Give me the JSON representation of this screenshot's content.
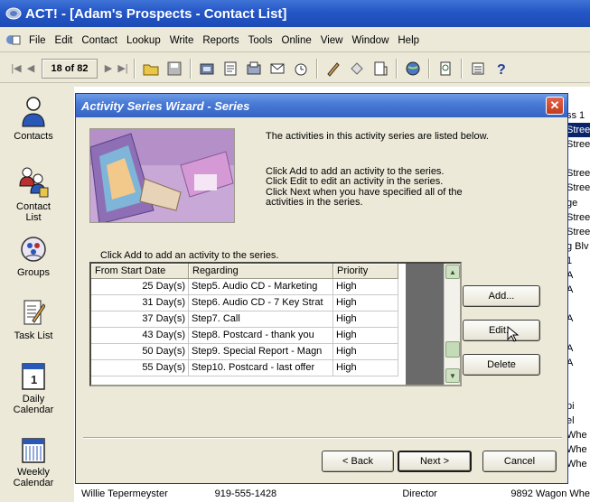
{
  "window": {
    "title": "ACT! - [Adam's Prospects - Contact List]"
  },
  "menubar": {
    "items": [
      "File",
      "Edit",
      "Contact",
      "Lookup",
      "Write",
      "Reports",
      "Tools",
      "Online",
      "View",
      "Window",
      "Help"
    ]
  },
  "toolbar": {
    "record_counter": "18 of 82"
  },
  "sidebar": {
    "items": [
      {
        "label": "Contacts",
        "icon": "person-icon"
      },
      {
        "label": "Contact List",
        "icon": "people-list-icon"
      },
      {
        "label": "Groups",
        "icon": "groups-icon"
      },
      {
        "label": "Task List",
        "icon": "task-list-icon"
      },
      {
        "label": "Daily Calendar",
        "icon": "daily-calendar-icon"
      },
      {
        "label": "Weekly Calendar",
        "icon": "weekly-calendar-icon"
      }
    ]
  },
  "background_list": {
    "column_fragments": [
      "ss 1",
      "Stree",
      "Stree",
      "",
      "Stree",
      "Stree",
      "ge",
      "Stree",
      "Stree",
      "g Blv",
      "1",
      "A",
      "A",
      "",
      "A",
      "",
      "A",
      "A",
      "",
      "",
      "pi",
      "el",
      "Whe",
      "Whe",
      "Whe"
    ],
    "bottom_row": {
      "name": "Willie Tepermeyster",
      "phone": "919-555-1428",
      "title": "Director",
      "address": "9892 Wagon Whe"
    }
  },
  "dialog": {
    "title": "Activity Series Wizard - Series",
    "intro_text": "The activities in this activity series are listed below.",
    "instructions": [
      "Click Add to add an activity to the series.",
      "Click Edit to edit an activity in the series.",
      "Click Next when you have specified all of the",
      "activities in the series."
    ],
    "list_label": "Click Add to add an activity to the series.",
    "table": {
      "headers": [
        "From Start Date",
        "Regarding",
        "Priority"
      ],
      "rows": [
        {
          "start": "25 Day(s)",
          "regarding": "Step5. Audio CD - Marketing",
          "priority": "High"
        },
        {
          "start": "31 Day(s)",
          "regarding": "Step6. Audio CD - 7 Key Strat",
          "priority": "High"
        },
        {
          "start": "37 Day(s)",
          "regarding": "Step7. Call",
          "priority": "High"
        },
        {
          "start": "43 Day(s)",
          "regarding": "Step8. Postcard - thank you",
          "priority": "High"
        },
        {
          "start": "50 Day(s)",
          "regarding": "Step9. Special Report - Magn",
          "priority": "High"
        },
        {
          "start": "55 Day(s)",
          "regarding": "Step10. Postcard - last offer",
          "priority": "High"
        }
      ]
    },
    "buttons": {
      "add": "Add...",
      "edit": "Edit...",
      "delete": "Delete",
      "back": "< Back",
      "next": "Next >",
      "cancel": "Cancel"
    }
  },
  "colors": {
    "title_blue": "#2456c6",
    "dialog_title_blue": "#4a7bd6",
    "window_bg": "#ece9d8",
    "selection_navy": "#0a246a",
    "close_red": "#d04a2c"
  }
}
